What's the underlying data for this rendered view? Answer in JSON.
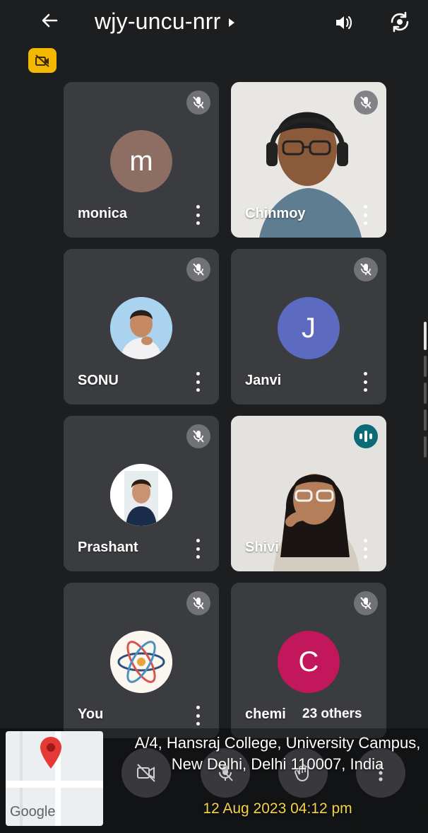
{
  "header": {
    "meeting_code": "wjy-uncu-nrr",
    "icons": {
      "back": "arrow-left-icon",
      "info": "caret-right-icon",
      "audio": "speaker-icon",
      "flip": "camera-flip-icon",
      "badge": "camera-off-badge-icon"
    },
    "badge_color": "#f5b800"
  },
  "participants": [
    {
      "name": "monica",
      "initial": "m",
      "avatar_color": "#8d6e63",
      "type": "initial",
      "muted": true
    },
    {
      "name": "Chinmoy",
      "initial": "",
      "type": "video",
      "muted": true
    },
    {
      "name": "SONU",
      "initial": "",
      "type": "photo",
      "muted": true
    },
    {
      "name": "Janvi",
      "initial": "J",
      "avatar_color": "#5c6bc0",
      "type": "initial",
      "muted": true
    },
    {
      "name": "Prashant",
      "initial": "",
      "type": "photo",
      "muted": true
    },
    {
      "name": "Shivi",
      "initial": "",
      "type": "video",
      "muted": false,
      "speaking": true
    },
    {
      "name": "You",
      "initial": "",
      "type": "photo",
      "muted": true
    },
    {
      "name": "chemi",
      "initial": "C",
      "avatar_color": "#c2185b",
      "type": "initial",
      "muted": true
    }
  ],
  "others_chip": "23 others",
  "controls": {
    "icons": [
      "camera-off-icon",
      "mic-off-icon",
      "raise-hand-icon",
      "more-vert-icon"
    ]
  },
  "overlay": {
    "map_brand": "Google",
    "address": "A/4, Hansraj College, University Campus, New Delhi, Delhi 110007, India",
    "timestamp": "12 Aug 2023 04:12 pm",
    "timestamp_color": "#f4d34a"
  },
  "colors": {
    "tile": "#3b3c3f",
    "background": "#1d1e20",
    "speaking_accent": "#0b6b77"
  }
}
